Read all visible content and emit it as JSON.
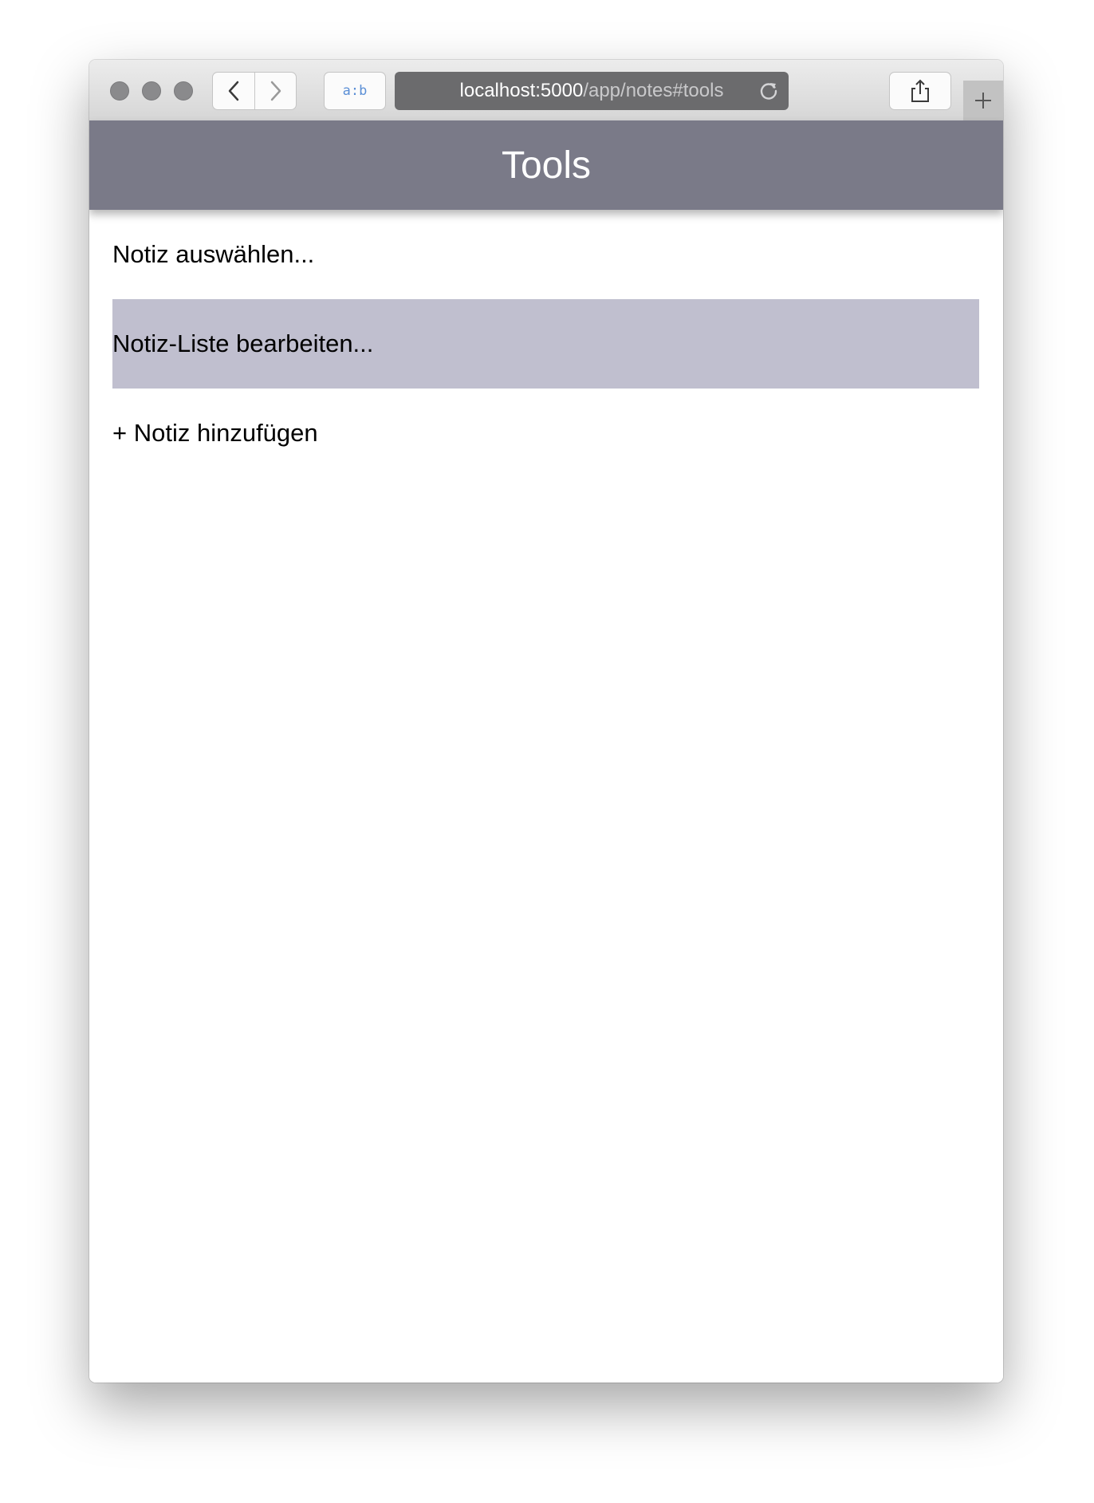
{
  "browser": {
    "ab_label": "a:b",
    "url_host": "localhost:5000",
    "url_path": "/app/notes#tools",
    "icons": [
      "back-arrow-icon",
      "forward-arrow-icon",
      "reload-icon",
      "share-icon",
      "plus-icon"
    ]
  },
  "header": {
    "title": "Tools"
  },
  "menu": {
    "items": [
      {
        "label": "Notiz auswählen..."
      },
      {
        "label": "Notiz-Liste bearbeiten..."
      },
      {
        "label": "+ Notiz hinzufügen"
      }
    ]
  },
  "colors": {
    "header_bg": "#7a7a88",
    "highlight_bg": "#c0bfcf",
    "address_bg": "#6b6b6d"
  }
}
